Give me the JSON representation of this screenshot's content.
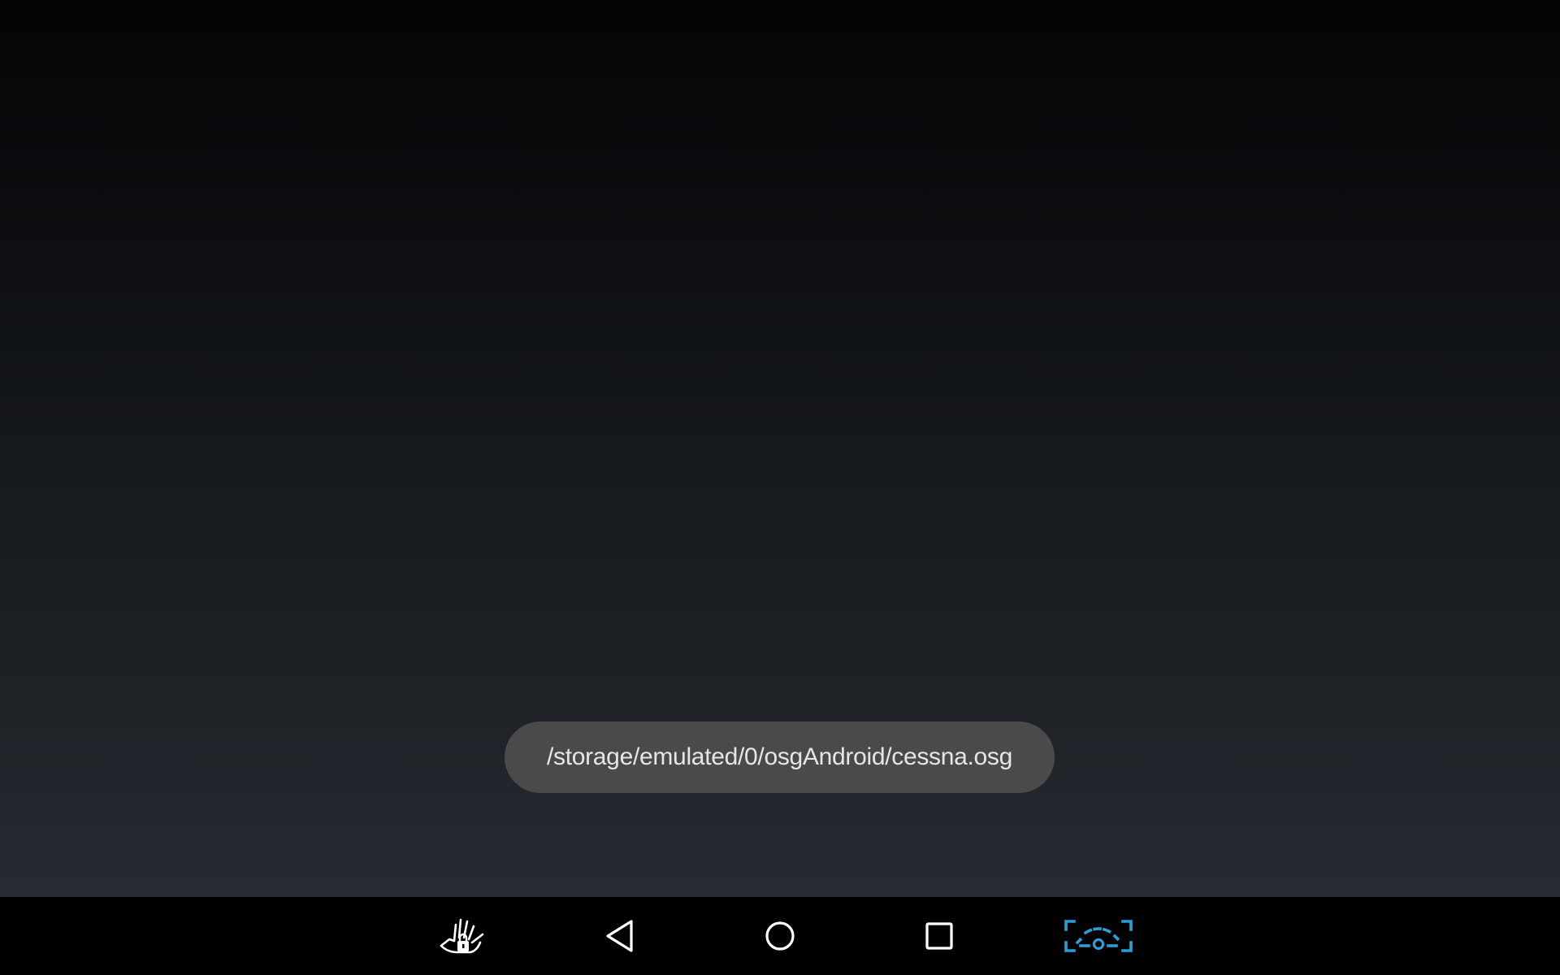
{
  "toast": {
    "message": "/storage/emulated/0/osgAndroid/cessna.osg"
  },
  "navbar": {
    "buttons": [
      {
        "icon": "gesture-lock-icon"
      },
      {
        "icon": "back-icon"
      },
      {
        "icon": "home-icon"
      },
      {
        "icon": "recents-icon"
      },
      {
        "icon": "screen-capture-icon"
      }
    ]
  },
  "colors": {
    "toast_background": "#4a4a4b",
    "navbar_background": "#000000",
    "nav_icon": "#ffffff",
    "capture_icon_accent": "#2a9fd6"
  }
}
